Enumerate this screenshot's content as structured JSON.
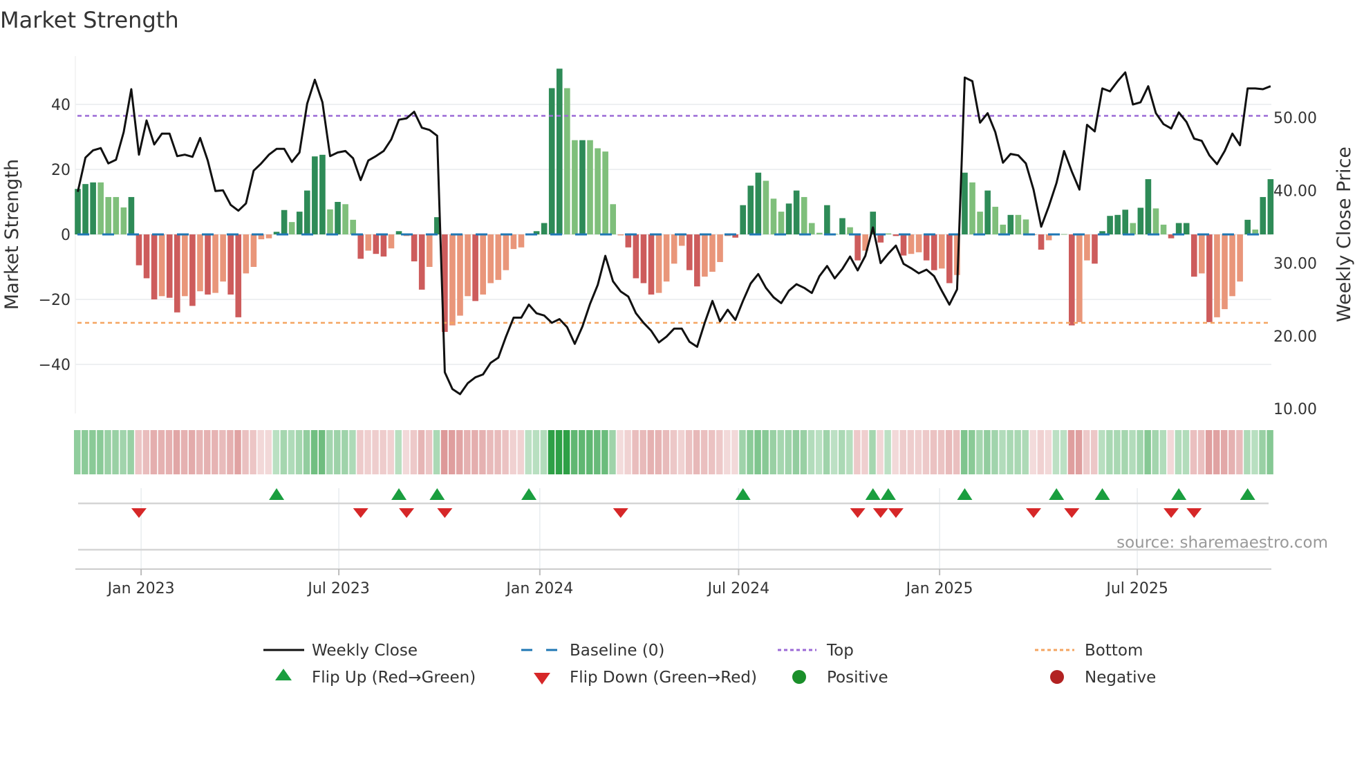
{
  "title": "Market Strength",
  "source": "source: sharemaestro.com",
  "chart_data": {
    "type": "bar",
    "title": "Market Strength",
    "ylabel": "Market Strength",
    "y2label": "Weekly Close Price",
    "ylim": [
      -55,
      55
    ],
    "y2lim": [
      9.4,
      58.5
    ],
    "frequency": "weekly",
    "start_date": "2022-11-04",
    "y_ticks": [
      {
        "v": 40,
        "label": "40"
      },
      {
        "v": 20,
        "label": "20"
      },
      {
        "v": 0,
        "label": "0"
      },
      {
        "v": -20,
        "label": "−20"
      },
      {
        "v": -40,
        "label": "−40"
      }
    ],
    "y2_ticks": [
      {
        "v": 50,
        "label": "50.00"
      },
      {
        "v": 40,
        "label": "40.00"
      },
      {
        "v": 30,
        "label": "30.00"
      },
      {
        "v": 20,
        "label": "20.00"
      },
      {
        "v": 10,
        "label": "10.00"
      }
    ],
    "x_ticks": [
      {
        "date": "2023-01-01",
        "label": "Jan 2023"
      },
      {
        "date": "2023-07-01",
        "label": "Jul 2023"
      },
      {
        "date": "2024-01-01",
        "label": "Jan 2024"
      },
      {
        "date": "2024-07-01",
        "label": "Jul 2024"
      },
      {
        "date": "2025-01-01",
        "label": "Jan 2025"
      },
      {
        "date": "2025-07-01",
        "label": "Jul 2025"
      }
    ],
    "top_level": 36.5,
    "bottom_level": -27.2,
    "baseline": 0,
    "strength": [
      14,
      15.5,
      16,
      16,
      11.5,
      11.5,
      8.3,
      11.5,
      -9.5,
      -13.5,
      -20,
      -19,
      -19.5,
      -24,
      -19,
      -22,
      -17.5,
      -18.5,
      -18,
      -14.5,
      -18.5,
      -25.5,
      -12,
      -10,
      -1.5,
      -1.2,
      0.8,
      7.5,
      3.8,
      7,
      13.5,
      24,
      24.5,
      7.7,
      10,
      9.3,
      4.5,
      -7.5,
      -5,
      -6,
      -6.8,
      -4.3,
      1,
      -0.5,
      -8.3,
      -17,
      -10,
      5.3,
      -30,
      -28,
      -25,
      -19,
      -20.5,
      -18.5,
      -15,
      -14,
      -11,
      -4.5,
      -4,
      0.3,
      1,
      3.5,
      45,
      51,
      45,
      29,
      29,
      29,
      26.5,
      25.5,
      9.3,
      -0.3,
      -4,
      -13.5,
      -15,
      -18.5,
      -18,
      -14.5,
      -9,
      -3.5,
      -11,
      -16,
      -13,
      -11.5,
      -8.5,
      -0.5,
      -1,
      9,
      15,
      19,
      16.5,
      11,
      7,
      9.5,
      13.5,
      11.5,
      3.5,
      0.5,
      9,
      0.2,
      5,
      2.2,
      -8,
      -5,
      7,
      -2.5,
      0.3,
      -0.5,
      -6.5,
      -6,
      -5.5,
      -8,
      -11,
      -10.5,
      -15,
      -12.5,
      19,
      16,
      7,
      13.5,
      8.5,
      3,
      6,
      6,
      4.6,
      -0.2,
      -4.7,
      -1.8,
      0.2,
      0.1,
      -28,
      -27,
      -8,
      -9,
      1,
      5.7,
      6,
      7.6,
      3.5,
      8.2,
      17,
      8,
      3,
      -1.2,
      3.5,
      3.5,
      -13,
      -12,
      -27,
      -25.5,
      -23,
      -19,
      -14.5,
      4.5,
      1.5,
      11.5,
      17
    ],
    "shade": [
      "d",
      "d",
      "d",
      "l",
      "l",
      "l",
      "l",
      "d",
      "d",
      "d",
      "d",
      "l",
      "d",
      "d",
      "l",
      "d",
      "l",
      "d",
      "l",
      "l",
      "d",
      "d",
      "l",
      "l",
      "l",
      "l",
      "d",
      "d",
      "l",
      "d",
      "d",
      "d",
      "d",
      "l",
      "d",
      "l",
      "l",
      "d",
      "l",
      "d",
      "d",
      "l",
      "d",
      "l",
      "d",
      "d",
      "l",
      "d",
      "d",
      "l",
      "l",
      "l",
      "d",
      "l",
      "l",
      "l",
      "l",
      "l",
      "l",
      "l",
      "d",
      "d",
      "d",
      "d",
      "l",
      "l",
      "d",
      "l",
      "l",
      "l",
      "l",
      "l",
      "d",
      "d",
      "d",
      "d",
      "l",
      "l",
      "l",
      "l",
      "d",
      "d",
      "l",
      "l",
      "l",
      "l",
      "d",
      "d",
      "d",
      "d",
      "l",
      "l",
      "l",
      "d",
      "d",
      "l",
      "l",
      "l",
      "d",
      "l",
      "d",
      "l",
      "d",
      "l",
      "d",
      "d",
      "l",
      "d",
      "d",
      "l",
      "l",
      "d",
      "d",
      "l",
      "d",
      "l",
      "d",
      "l",
      "l",
      "d",
      "l",
      "l",
      "d",
      "l",
      "l",
      "l",
      "d",
      "l",
      "l",
      "l",
      "d",
      "l",
      "l",
      "d",
      "d",
      "d",
      "d",
      "d",
      "l",
      "d",
      "d",
      "l",
      "l",
      "d",
      "d",
      "d",
      "d",
      "l",
      "d",
      "l",
      "l",
      "l",
      "l",
      "d",
      "l",
      "d",
      "d"
    ],
    "weekly_close": [
      39.8,
      44.5,
      45.5,
      45.8,
      43.7,
      44.2,
      48,
      53.9,
      44.9,
      49.6,
      46.3,
      47.8,
      47.8,
      44.7,
      44.9,
      44.6,
      47.2,
      44.1,
      39.9,
      40,
      38,
      37.2,
      38.2,
      42.7,
      43.7,
      44.9,
      45.7,
      45.7,
      43.9,
      45.2,
      51.9,
      55.2,
      52.1,
      44.7,
      45.2,
      45.4,
      44.4,
      41.4,
      44.1,
      44.7,
      45.4,
      47,
      49.7,
      49.9,
      50.8,
      48.6,
      48.3,
      47.5,
      15,
      12.7,
      12,
      13.5,
      14.3,
      14.7,
      16.3,
      17,
      19.9,
      22.5,
      22.5,
      24.3,
      23.1,
      22.8,
      21.8,
      22.3,
      21.2,
      18.9,
      21.3,
      24.4,
      27,
      31,
      27.5,
      26.1,
      25.4,
      23.1,
      21.8,
      20.7,
      19.1,
      19.9,
      21,
      21,
      19.2,
      18.5,
      21.8,
      24.8,
      22,
      23.6,
      22.2,
      24.8,
      27.2,
      28.5,
      26.6,
      25.3,
      24.5,
      26.2,
      27.1,
      26.6,
      25.9,
      28.2,
      29.6,
      27.9,
      29.2,
      30.9,
      29,
      31,
      34.9,
      30,
      31.3,
      32.4,
      29.9,
      29.3,
      28.6,
      29.1,
      28.2,
      26.2,
      24.3,
      26.4,
      55.5,
      55,
      49.3,
      50.6,
      48,
      43.8,
      45,
      44.8,
      43.7,
      40.1,
      35,
      37.8,
      41,
      45.4,
      42.6,
      40.1,
      49,
      48.1,
      54,
      53.6,
      55,
      56.2,
      51.8,
      52.1,
      54.3,
      50.6,
      49.1,
      48.5,
      50.7,
      49.4,
      47.1,
      46.8,
      44.8,
      43.6,
      45.4,
      47.8,
      46.2,
      54,
      54,
      53.9,
      54.3
    ],
    "flip_up_weeks": [
      26,
      42,
      47,
      59,
      87,
      104,
      106,
      116,
      128,
      134,
      144,
      153
    ],
    "flip_down_weeks": [
      8,
      37,
      43,
      48,
      71,
      102,
      105,
      107,
      125,
      130,
      143,
      146
    ],
    "legend": {
      "placement": "bottom",
      "items": [
        {
          "key": "weekly_close",
          "label": "Weekly Close"
        },
        {
          "key": "baseline",
          "label": "Baseline (0)"
        },
        {
          "key": "top",
          "label": "Top"
        },
        {
          "key": "bottom",
          "label": "Bottom"
        },
        {
          "key": "flip_up",
          "label": "Flip Up (Red→Green)"
        },
        {
          "key": "flip_down",
          "label": "Flip Down (Green→Red)"
        },
        {
          "key": "positive",
          "label": "Positive"
        },
        {
          "key": "negative",
          "label": "Negative"
        }
      ]
    },
    "colors": {
      "pos_strong": "#2e8b57",
      "pos_weak": "#7fbf7b",
      "neg_strong": "#cd5c5c",
      "neg_weak": "#e9967a",
      "line": "#111111",
      "baseline": "#1f77b4",
      "top": "#9b6ad6",
      "bottom": "#f4a460",
      "flip_up": "#1a9e3f",
      "flip_down": "#d62728",
      "positive": "#1a8f2a",
      "negative": "#b22222"
    }
  }
}
